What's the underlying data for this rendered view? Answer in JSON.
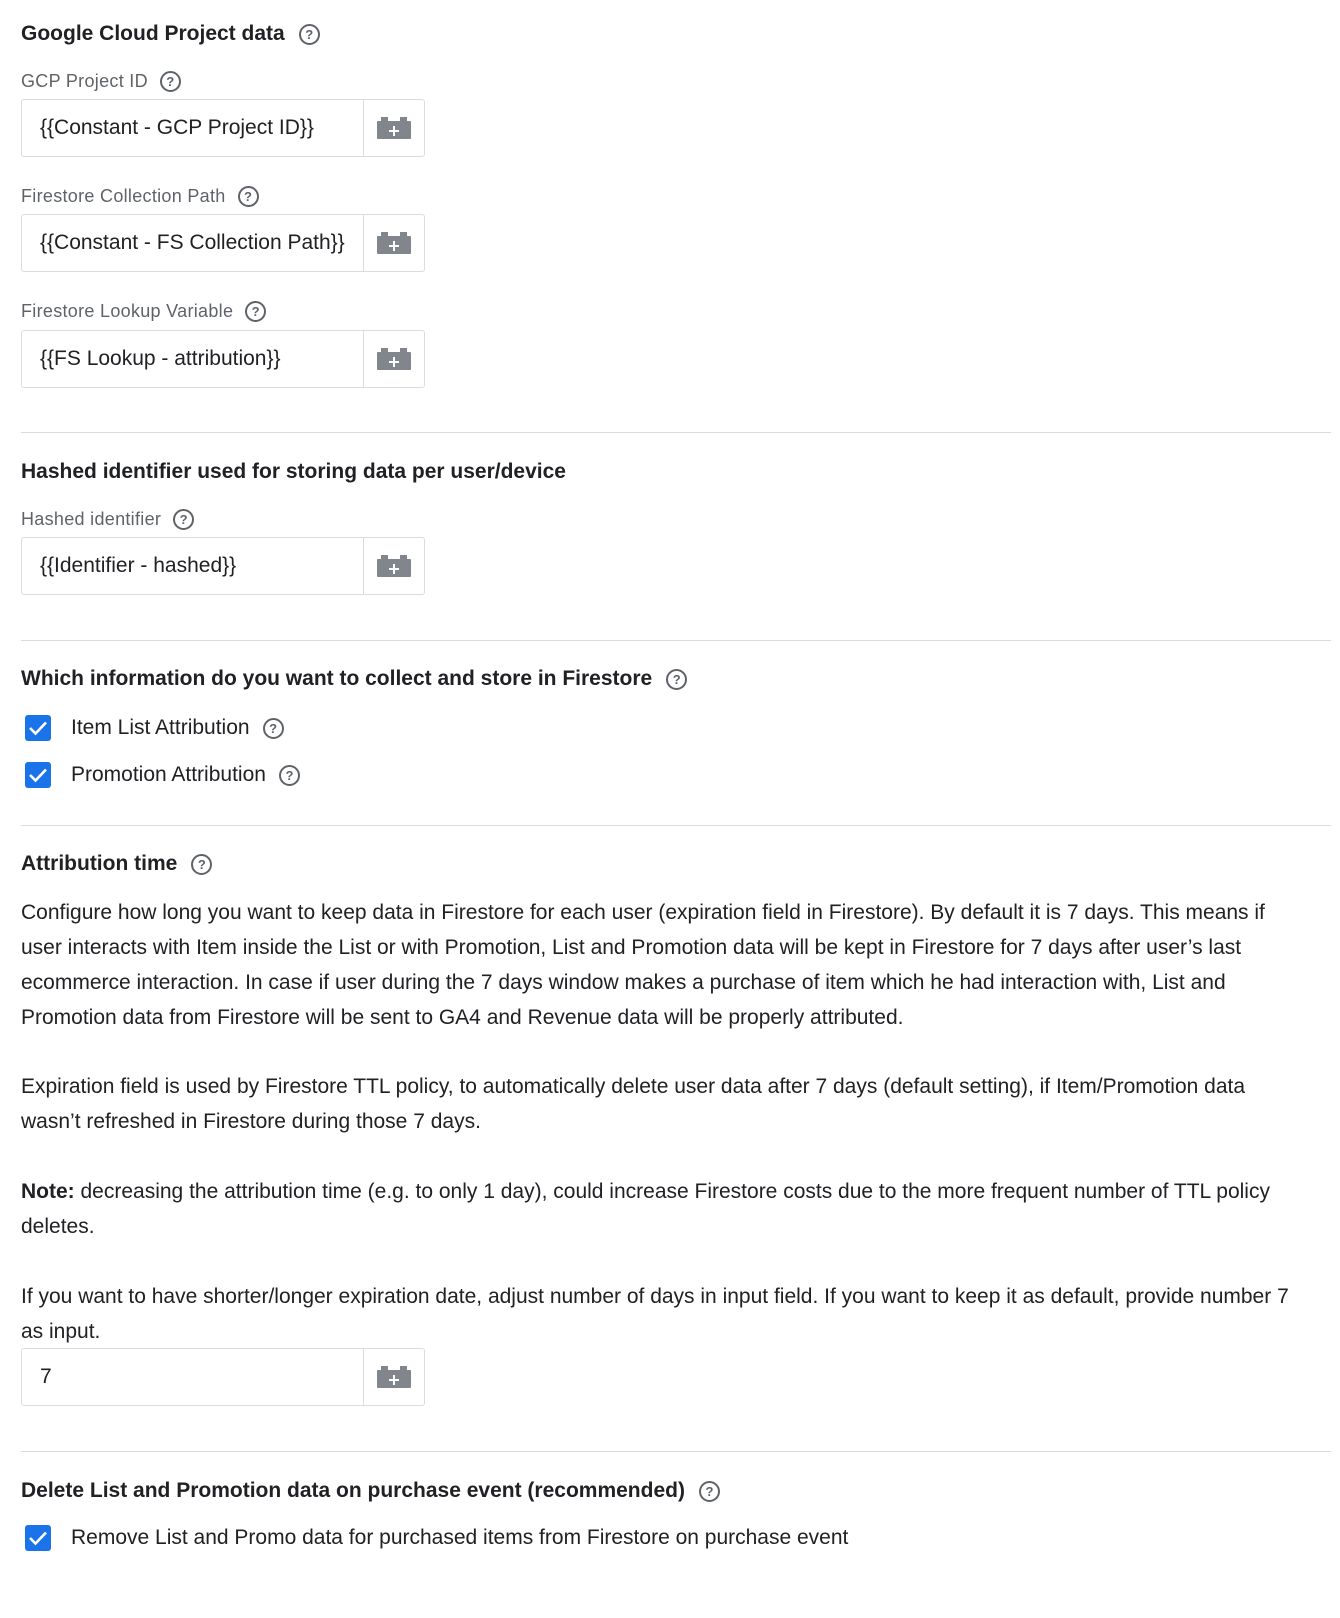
{
  "gcp_section": {
    "title": "Google Cloud Project data",
    "fields": [
      {
        "label": "GCP Project ID",
        "value": "{{Constant - GCP Project ID}}"
      },
      {
        "label": "Firestore Collection Path",
        "value": "{{Constant - FS Collection Path}}"
      },
      {
        "label": "Firestore Lookup Variable",
        "value": "{{FS Lookup - attribution}}"
      }
    ]
  },
  "hash_section": {
    "title": "Hashed identifier used for storing data per user/device",
    "field": {
      "label": "Hashed identifier",
      "value": "{{Identifier - hashed}}"
    }
  },
  "collect_section": {
    "title": "Which information do you want to collect and store in Firestore",
    "options": [
      {
        "label": "Item List Attribution",
        "checked": true
      },
      {
        "label": "Promotion Attribution",
        "checked": true
      }
    ]
  },
  "attribution_section": {
    "title": "Attribution time",
    "paragraph1": "Configure how long you want to keep data in Firestore for each user (expiration field in Firestore). By default it is 7 days. This means if user interacts with Item inside the List or with Promotion, List and Promotion data will be kept in Firestore for 7 days after user’s last ecommerce interaction. In case if user during the 7 days window makes a purchase of item which he had interaction with, List and Promotion data from Firestore will be sent to GA4 and Revenue data will be properly attributed.",
    "paragraph2": "Expiration field is used by Firestore TTL policy, to automatically delete user data after 7 days (default setting), if Item/Promotion data wasn’t refreshed in Firestore during those 7 days.",
    "note_label": "Note:",
    "note_text": " decreasing the attribution time (e.g. to only 1 day), could increase Firestore costs due to the more frequent number of TTL policy deletes.",
    "paragraph4": "If you want to have shorter/longer expiration date, adjust number of days in input field. If you want to keep it as default, provide number 7 as input.",
    "days_value": "7"
  },
  "delete_section": {
    "title": "Delete List and Promotion data on purchase event (recommended)",
    "option": {
      "label": "Remove List and Promo data for purchased items from Firestore on purchase event",
      "checked": true
    }
  },
  "colors": {
    "accent": "#1a73e8",
    "divider": "#dadce0",
    "label": "#5f6368"
  }
}
